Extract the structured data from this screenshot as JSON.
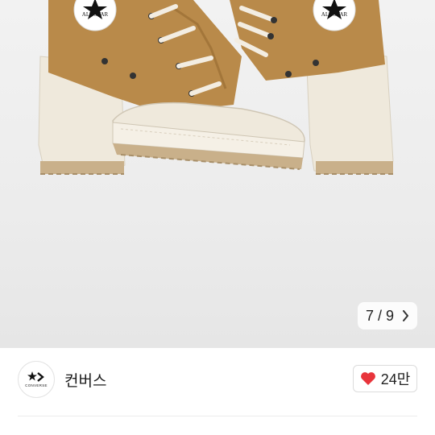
{
  "carousel": {
    "current": "7",
    "separator": "/",
    "total": "9",
    "next_icon": "chevron-right-icon"
  },
  "seller": {
    "brand_name": "컨버스",
    "logo_text": "CONVERSE",
    "logo_icon": "converse-star-chevron-logo"
  },
  "like": {
    "count": "24만",
    "icon": "heart-icon",
    "color": "#e8343b"
  },
  "colors": {
    "shoe_canvas": "#b98a4a",
    "sole": "#efe9dc",
    "outsole": "#c9b08a"
  }
}
